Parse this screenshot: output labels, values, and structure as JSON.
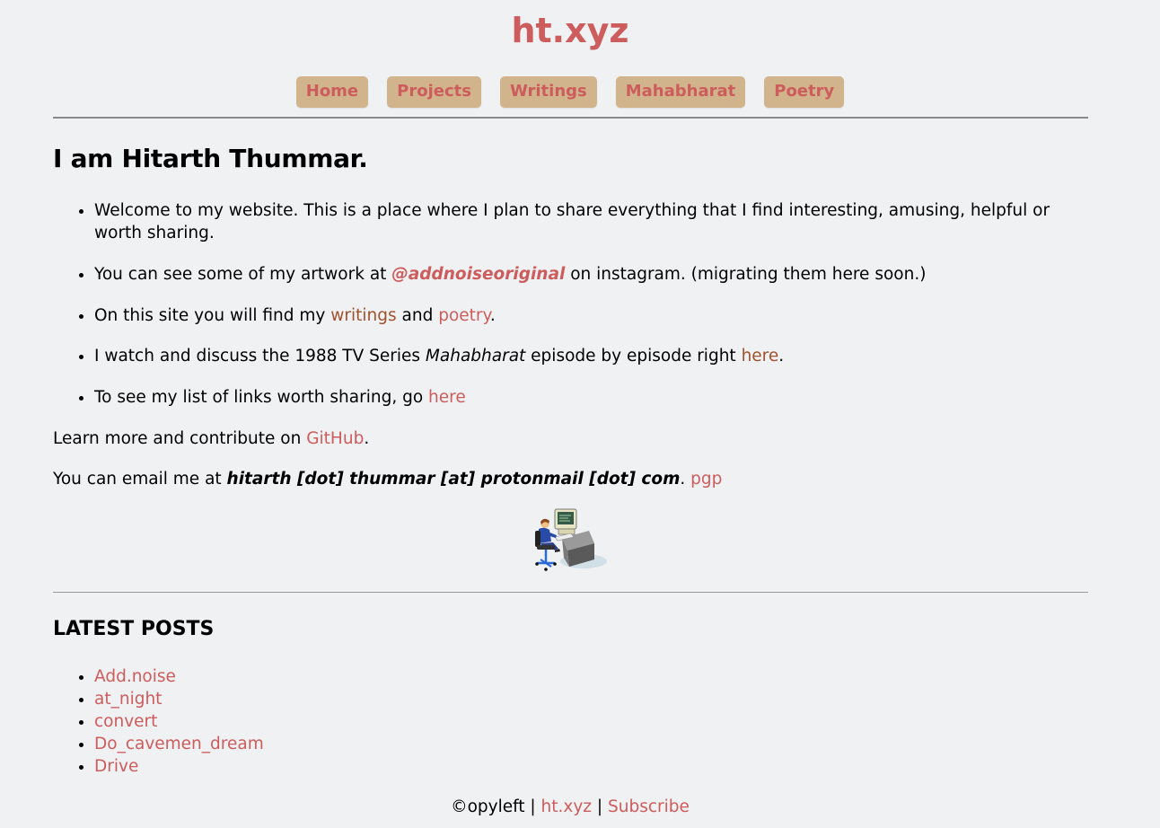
{
  "site": {
    "title": "ht.xyz"
  },
  "nav": {
    "items": [
      {
        "label": "Home"
      },
      {
        "label": "Projects"
      },
      {
        "label": "Writings"
      },
      {
        "label": "Mahabharat"
      },
      {
        "label": "Poetry"
      }
    ]
  },
  "main": {
    "heading": "I am Hitarth Thummar.",
    "intro": {
      "item1": "Welcome to my website. This is a place where I plan to share everything that I find interesting, amusing, helpful or worth sharing.",
      "item2": {
        "pre": "You can see some of my artwork at ",
        "link": "@addnoiseoriginal",
        "post": " on instagram. (migrating them here soon.)"
      },
      "item3": {
        "pre": "On this site you will find my ",
        "link1": "writings",
        "mid": " and ",
        "link2": "poetry",
        "post": "."
      },
      "item4": {
        "pre": "I watch and discuss the 1988 TV Series ",
        "em": "Mahabharat",
        "mid": " episode by episode right ",
        "link": "here",
        "post": "."
      },
      "item5": {
        "pre": "To see my list of links worth sharing, go ",
        "link": "here"
      }
    },
    "github_para": {
      "pre": "Learn more and contribute on ",
      "link": "GitHub",
      "post": "."
    },
    "email_para": {
      "pre": "You can email me at ",
      "email": "hitarth [dot] thummar [at] protonmail [dot] com",
      "post": ". ",
      "link": "pgp"
    }
  },
  "latest": {
    "heading": "LATEST POSTS",
    "posts": [
      {
        "label": "Add.noise"
      },
      {
        "label": "at_night"
      },
      {
        "label": "convert"
      },
      {
        "label": "Do_cavemen_dream"
      },
      {
        "label": "Drive"
      }
    ]
  },
  "footer": {
    "copy": "©opyleft",
    "sep1": " | ",
    "site_link": "ht.xyz",
    "sep2": " | ",
    "subscribe": "Subscribe"
  },
  "colors": {
    "accent": "#cd5c5c",
    "link_brown": "#a0522d",
    "nav_bg": "#d2b48c",
    "page_bg": "#f0f1f3"
  },
  "icons": {
    "illustration": "person-at-computer-icon"
  }
}
